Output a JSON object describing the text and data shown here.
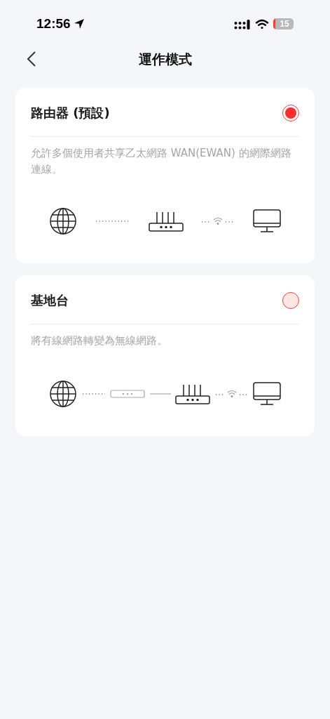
{
  "status_bar": {
    "time": "12:56",
    "battery": "15"
  },
  "header": {
    "title": "運作模式"
  },
  "modes": [
    {
      "kind": "router",
      "title": "路由器 (預設)",
      "description": "允許多個使用者共享乙太網路 WAN(EWAN) 的網際網路連線。",
      "selected": true
    },
    {
      "kind": "access_point",
      "title": "基地台",
      "description": "將有線網路轉變為無線網路。",
      "selected": false
    }
  ]
}
